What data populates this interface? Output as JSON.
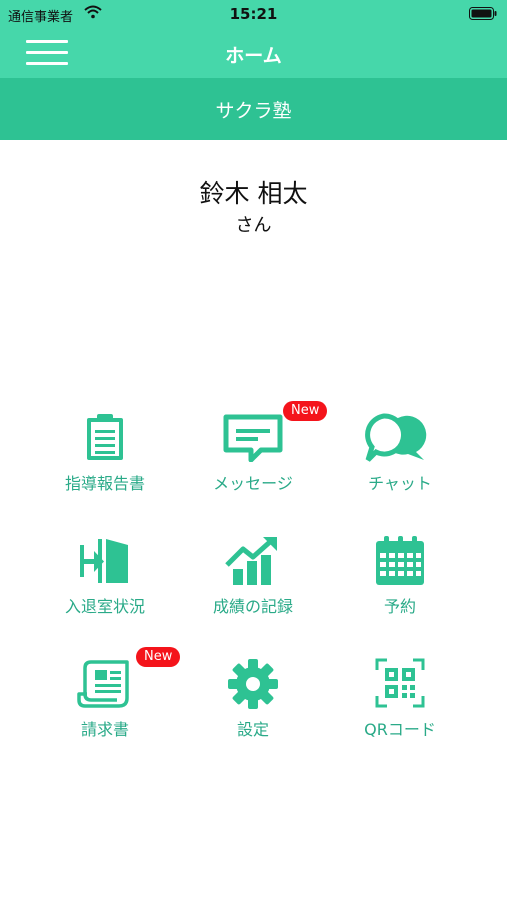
{
  "status_bar": {
    "carrier": "通信事業者",
    "time": "15:21"
  },
  "header": {
    "title": "ホーム"
  },
  "school": {
    "name": "サクラ塾"
  },
  "user": {
    "name": "鈴木 相太",
    "suffix": "さん"
  },
  "badge_text": "New",
  "colors": {
    "header": "#46d7aa",
    "school_bar": "#2ec293",
    "icon": "#2ec293",
    "label": "#2aaa88",
    "badge": "#f4141b"
  },
  "menu": [
    {
      "label": "指導報告書",
      "icon": "clipboard-icon",
      "badge": false
    },
    {
      "label": "メッセージ",
      "icon": "message-icon",
      "badge": true
    },
    {
      "label": "チャット",
      "icon": "chat-bubbles-icon",
      "badge": false
    },
    {
      "label": "入退室状況",
      "icon": "door-enter-icon",
      "badge": false
    },
    {
      "label": "成績の記録",
      "icon": "growth-chart-icon",
      "badge": false
    },
    {
      "label": "予約",
      "icon": "calendar-icon",
      "badge": false
    },
    {
      "label": "請求書",
      "icon": "invoice-scroll-icon",
      "badge": true
    },
    {
      "label": "設定",
      "icon": "gear-icon",
      "badge": false
    },
    {
      "label": "QRコード",
      "icon": "qr-code-icon",
      "badge": false
    }
  ]
}
